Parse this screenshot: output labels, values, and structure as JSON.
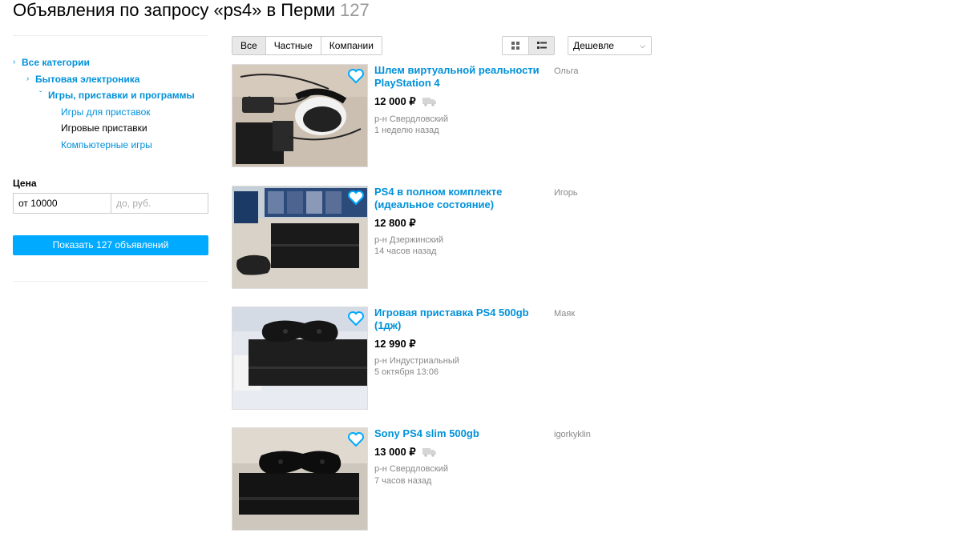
{
  "header": {
    "title": "Объявления по запросу «ps4» в Перми",
    "count": "127"
  },
  "sidebar": {
    "categories": [
      {
        "label": "Все категории",
        "indent": 0,
        "chevron": "›",
        "style": "link"
      },
      {
        "label": "Бытовая электроника",
        "indent": 1,
        "chevron": "›",
        "style": "link"
      },
      {
        "label": "Игры, приставки и программы",
        "indent": 2,
        "chevron": "ˇ",
        "style": "link"
      },
      {
        "label": "Игры для приставок",
        "indent": 3,
        "chevron": "",
        "style": "sub"
      },
      {
        "label": "Игровые приставки",
        "indent": 3,
        "chevron": "",
        "style": "current"
      },
      {
        "label": "Компьютерные игры",
        "indent": 3,
        "chevron": "",
        "style": "sub"
      }
    ],
    "price_label": "Цена",
    "price_from_value": "от 10000",
    "price_to_placeholder": "до, руб.",
    "show_button": "Показать 127 объявлений"
  },
  "toolbar": {
    "filters": [
      "Все",
      "Частные",
      "Компании"
    ],
    "active_filter": 0,
    "sort_value": "Дешевле"
  },
  "listings": [
    {
      "title": "Шлем виртуальной реальности PlayStation 4",
      "price": "12 000 ₽",
      "delivery": true,
      "district": "р-н Свердловский",
      "time": "1 неделю назад",
      "seller": "Ольга"
    },
    {
      "title": "PS4 в полном комплекте (идеальное состояние)",
      "price": "12 800 ₽",
      "delivery": false,
      "district": "р-н Дзержинский",
      "time": "14 часов назад",
      "seller": "Игорь"
    },
    {
      "title": "Игровая приставка PS4 500gb (1дж)",
      "price": "12 990 ₽",
      "delivery": false,
      "district": "р-н Индустриальный",
      "time": "5 октября 13:06",
      "seller": "Маяк"
    },
    {
      "title": "Sony PS4 slim 500gb",
      "price": "13 000 ₽",
      "delivery": true,
      "district": "р-н Свердловский",
      "time": "7 часов назад",
      "seller": "igorkyklin"
    }
  ],
  "colors": {
    "link": "#0091d9",
    "button": "#00aaff",
    "muted": "#888888"
  }
}
